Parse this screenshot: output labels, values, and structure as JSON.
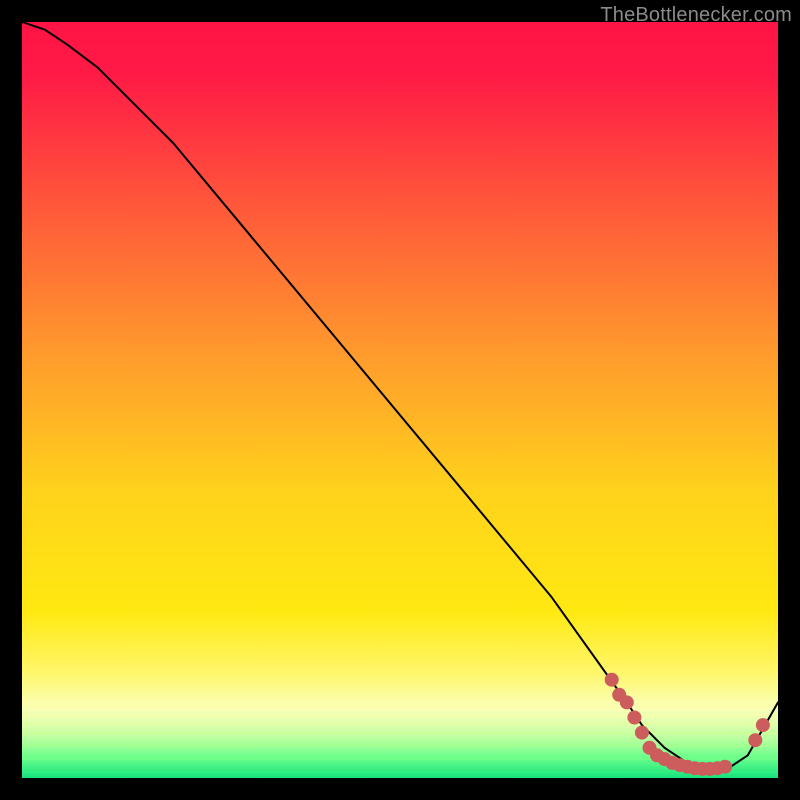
{
  "watermark": "TheBottlenecker.com",
  "chart_data": {
    "type": "line",
    "title": "",
    "xlabel": "",
    "ylabel": "",
    "xlim": [
      0,
      100
    ],
    "ylim": [
      0,
      100
    ],
    "background": {
      "style": "vertical-gradient",
      "top_color": "#ff1744",
      "mid_color": "#ffd600",
      "bottom_band_top": "#f6ffb0",
      "bottom_band_bottom": "#00e676"
    },
    "series": [
      {
        "name": "curve",
        "x": [
          0,
          3,
          6,
          10,
          15,
          20,
          30,
          40,
          50,
          60,
          70,
          75,
          80,
          82,
          85,
          88,
          90,
          93,
          96,
          100
        ],
        "y": [
          100,
          99,
          97,
          94,
          89,
          84,
          72,
          60,
          48,
          36,
          24,
          17,
          10,
          7,
          4,
          2,
          1,
          1,
          3,
          10
        ],
        "stroke": "#000000",
        "stroke_width": 2
      }
    ],
    "points": [
      {
        "x": 78,
        "y": 13
      },
      {
        "x": 79,
        "y": 11
      },
      {
        "x": 80,
        "y": 10
      },
      {
        "x": 81,
        "y": 8
      },
      {
        "x": 82,
        "y": 6
      },
      {
        "x": 83,
        "y": 4
      },
      {
        "x": 84,
        "y": 3
      },
      {
        "x": 85,
        "y": 2.5
      },
      {
        "x": 86,
        "y": 2
      },
      {
        "x": 87,
        "y": 1.7
      },
      {
        "x": 88,
        "y": 1.5
      },
      {
        "x": 89,
        "y": 1.3
      },
      {
        "x": 90,
        "y": 1.2
      },
      {
        "x": 91,
        "y": 1.2
      },
      {
        "x": 92,
        "y": 1.3
      },
      {
        "x": 93,
        "y": 1.5
      },
      {
        "x": 97,
        "y": 5
      },
      {
        "x": 98,
        "y": 7
      }
    ],
    "point_style": {
      "fill": "#cd5c5c",
      "r": 7
    }
  }
}
